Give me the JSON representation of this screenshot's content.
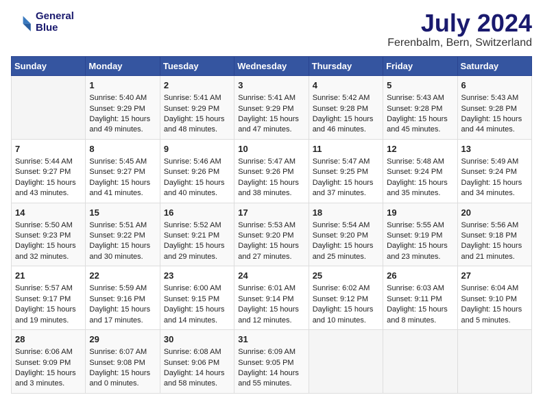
{
  "header": {
    "logo_line1": "General",
    "logo_line2": "Blue",
    "month_year": "July 2024",
    "location": "Ferenbalm, Bern, Switzerland"
  },
  "days_of_week": [
    "Sunday",
    "Monday",
    "Tuesday",
    "Wednesday",
    "Thursday",
    "Friday",
    "Saturday"
  ],
  "weeks": [
    [
      {
        "day": "",
        "sunrise": "",
        "sunset": "",
        "daylight": ""
      },
      {
        "day": "1",
        "sunrise": "Sunrise: 5:40 AM",
        "sunset": "Sunset: 9:29 PM",
        "daylight": "Daylight: 15 hours and 49 minutes."
      },
      {
        "day": "2",
        "sunrise": "Sunrise: 5:41 AM",
        "sunset": "Sunset: 9:29 PM",
        "daylight": "Daylight: 15 hours and 48 minutes."
      },
      {
        "day": "3",
        "sunrise": "Sunrise: 5:41 AM",
        "sunset": "Sunset: 9:29 PM",
        "daylight": "Daylight: 15 hours and 47 minutes."
      },
      {
        "day": "4",
        "sunrise": "Sunrise: 5:42 AM",
        "sunset": "Sunset: 9:28 PM",
        "daylight": "Daylight: 15 hours and 46 minutes."
      },
      {
        "day": "5",
        "sunrise": "Sunrise: 5:43 AM",
        "sunset": "Sunset: 9:28 PM",
        "daylight": "Daylight: 15 hours and 45 minutes."
      },
      {
        "day": "6",
        "sunrise": "Sunrise: 5:43 AM",
        "sunset": "Sunset: 9:28 PM",
        "daylight": "Daylight: 15 hours and 44 minutes."
      }
    ],
    [
      {
        "day": "7",
        "sunrise": "Sunrise: 5:44 AM",
        "sunset": "Sunset: 9:27 PM",
        "daylight": "Daylight: 15 hours and 43 minutes."
      },
      {
        "day": "8",
        "sunrise": "Sunrise: 5:45 AM",
        "sunset": "Sunset: 9:27 PM",
        "daylight": "Daylight: 15 hours and 41 minutes."
      },
      {
        "day": "9",
        "sunrise": "Sunrise: 5:46 AM",
        "sunset": "Sunset: 9:26 PM",
        "daylight": "Daylight: 15 hours and 40 minutes."
      },
      {
        "day": "10",
        "sunrise": "Sunrise: 5:47 AM",
        "sunset": "Sunset: 9:26 PM",
        "daylight": "Daylight: 15 hours and 38 minutes."
      },
      {
        "day": "11",
        "sunrise": "Sunrise: 5:47 AM",
        "sunset": "Sunset: 9:25 PM",
        "daylight": "Daylight: 15 hours and 37 minutes."
      },
      {
        "day": "12",
        "sunrise": "Sunrise: 5:48 AM",
        "sunset": "Sunset: 9:24 PM",
        "daylight": "Daylight: 15 hours and 35 minutes."
      },
      {
        "day": "13",
        "sunrise": "Sunrise: 5:49 AM",
        "sunset": "Sunset: 9:24 PM",
        "daylight": "Daylight: 15 hours and 34 minutes."
      }
    ],
    [
      {
        "day": "14",
        "sunrise": "Sunrise: 5:50 AM",
        "sunset": "Sunset: 9:23 PM",
        "daylight": "Daylight: 15 hours and 32 minutes."
      },
      {
        "day": "15",
        "sunrise": "Sunrise: 5:51 AM",
        "sunset": "Sunset: 9:22 PM",
        "daylight": "Daylight: 15 hours and 30 minutes."
      },
      {
        "day": "16",
        "sunrise": "Sunrise: 5:52 AM",
        "sunset": "Sunset: 9:21 PM",
        "daylight": "Daylight: 15 hours and 29 minutes."
      },
      {
        "day": "17",
        "sunrise": "Sunrise: 5:53 AM",
        "sunset": "Sunset: 9:20 PM",
        "daylight": "Daylight: 15 hours and 27 minutes."
      },
      {
        "day": "18",
        "sunrise": "Sunrise: 5:54 AM",
        "sunset": "Sunset: 9:20 PM",
        "daylight": "Daylight: 15 hours and 25 minutes."
      },
      {
        "day": "19",
        "sunrise": "Sunrise: 5:55 AM",
        "sunset": "Sunset: 9:19 PM",
        "daylight": "Daylight: 15 hours and 23 minutes."
      },
      {
        "day": "20",
        "sunrise": "Sunrise: 5:56 AM",
        "sunset": "Sunset: 9:18 PM",
        "daylight": "Daylight: 15 hours and 21 minutes."
      }
    ],
    [
      {
        "day": "21",
        "sunrise": "Sunrise: 5:57 AM",
        "sunset": "Sunset: 9:17 PM",
        "daylight": "Daylight: 15 hours and 19 minutes."
      },
      {
        "day": "22",
        "sunrise": "Sunrise: 5:59 AM",
        "sunset": "Sunset: 9:16 PM",
        "daylight": "Daylight: 15 hours and 17 minutes."
      },
      {
        "day": "23",
        "sunrise": "Sunrise: 6:00 AM",
        "sunset": "Sunset: 9:15 PM",
        "daylight": "Daylight: 15 hours and 14 minutes."
      },
      {
        "day": "24",
        "sunrise": "Sunrise: 6:01 AM",
        "sunset": "Sunset: 9:14 PM",
        "daylight": "Daylight: 15 hours and 12 minutes."
      },
      {
        "day": "25",
        "sunrise": "Sunrise: 6:02 AM",
        "sunset": "Sunset: 9:12 PM",
        "daylight": "Daylight: 15 hours and 10 minutes."
      },
      {
        "day": "26",
        "sunrise": "Sunrise: 6:03 AM",
        "sunset": "Sunset: 9:11 PM",
        "daylight": "Daylight: 15 hours and 8 minutes."
      },
      {
        "day": "27",
        "sunrise": "Sunrise: 6:04 AM",
        "sunset": "Sunset: 9:10 PM",
        "daylight": "Daylight: 15 hours and 5 minutes."
      }
    ],
    [
      {
        "day": "28",
        "sunrise": "Sunrise: 6:06 AM",
        "sunset": "Sunset: 9:09 PM",
        "daylight": "Daylight: 15 hours and 3 minutes."
      },
      {
        "day": "29",
        "sunrise": "Sunrise: 6:07 AM",
        "sunset": "Sunset: 9:08 PM",
        "daylight": "Daylight: 15 hours and 0 minutes."
      },
      {
        "day": "30",
        "sunrise": "Sunrise: 6:08 AM",
        "sunset": "Sunset: 9:06 PM",
        "daylight": "Daylight: 14 hours and 58 minutes."
      },
      {
        "day": "31",
        "sunrise": "Sunrise: 6:09 AM",
        "sunset": "Sunset: 9:05 PM",
        "daylight": "Daylight: 14 hours and 55 minutes."
      },
      {
        "day": "",
        "sunrise": "",
        "sunset": "",
        "daylight": ""
      },
      {
        "day": "",
        "sunrise": "",
        "sunset": "",
        "daylight": ""
      },
      {
        "day": "",
        "sunrise": "",
        "sunset": "",
        "daylight": ""
      }
    ]
  ]
}
